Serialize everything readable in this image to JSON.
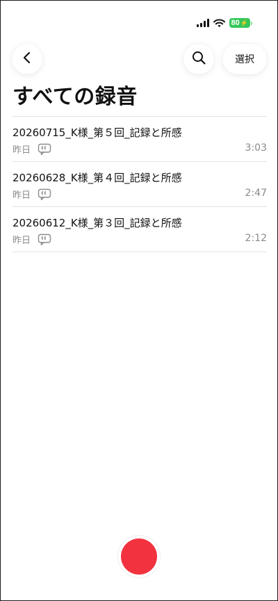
{
  "status_bar": {
    "battery_level": "80",
    "battery_color": "#35c759",
    "icons": [
      "signal-bars-icon",
      "wifi-icon",
      "battery-icon"
    ]
  },
  "nav": {
    "back_icon": "chevron-left-icon",
    "search_icon": "search-icon",
    "select_label": "選択"
  },
  "page": {
    "title": "すべての録音"
  },
  "recordings": [
    {
      "title": "20260715_K様_第５回_記録と所感",
      "date": "昨日",
      "duration": "3:03"
    },
    {
      "title": "20260628_K様_第４回_記録と所感",
      "date": "昨日",
      "duration": "2:47"
    },
    {
      "title": "20260612_K様_第３回_記録と所感",
      "date": "昨日",
      "duration": "2:12"
    }
  ],
  "record_button": {
    "color": "#f2333f"
  }
}
